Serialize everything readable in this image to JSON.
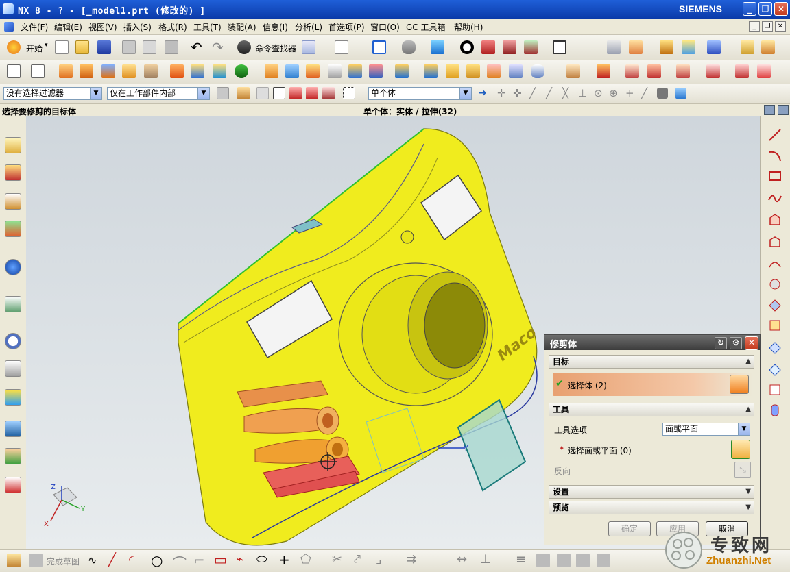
{
  "window": {
    "title": "NX 8 - ? - [_model1.prt  (修改的) ]",
    "brand": "SIEMENS"
  },
  "menu": [
    "文件(F)",
    "编辑(E)",
    "视图(V)",
    "插入(S)",
    "格式(R)",
    "工具(T)",
    "装配(A)",
    "信息(I)",
    "分析(L)",
    "首选项(P)",
    "窗口(O)",
    "GC 工具箱",
    "帮助(H)"
  ],
  "toolbar1": {
    "start_label": "开始",
    "command_finder": "命令查找器"
  },
  "toolbar3": {
    "filter_value": "没有选择过滤器",
    "scope_value": "仅在工作部件内部",
    "body_rule": "单个体"
  },
  "cue": {
    "prompt": "选择要修剪的目标体",
    "status": "单个体：实体 / 拉伸(32)"
  },
  "viewport": {
    "brand_text": "Maco",
    "triad_z": "Z",
    "triad_y": "Y",
    "triad_x": "X",
    "csys_y": "Y"
  },
  "dialog": {
    "title": "修剪体",
    "target_section": "目标",
    "select_body": "选择体 (2)",
    "tool_section": "工具",
    "tool_option_label": "工具选项",
    "tool_option_value": "面或平面",
    "select_face": "选择面或平面 (0)",
    "reverse": "反向",
    "settings_section": "设置",
    "preview_section": "预览",
    "ok": "确定",
    "apply": "应用",
    "cancel": "取消"
  },
  "bottombar": {
    "finish_sketch": "完成草图"
  },
  "watermark": {
    "site_cn": "专致网",
    "site_url": "Zhuanzhi.Net"
  },
  "colors": {
    "model_yellow": "#f0ec1e",
    "accent_orange": "#f0a050",
    "tool_red": "#e8605a",
    "plane_teal": "#a8d8d0"
  }
}
